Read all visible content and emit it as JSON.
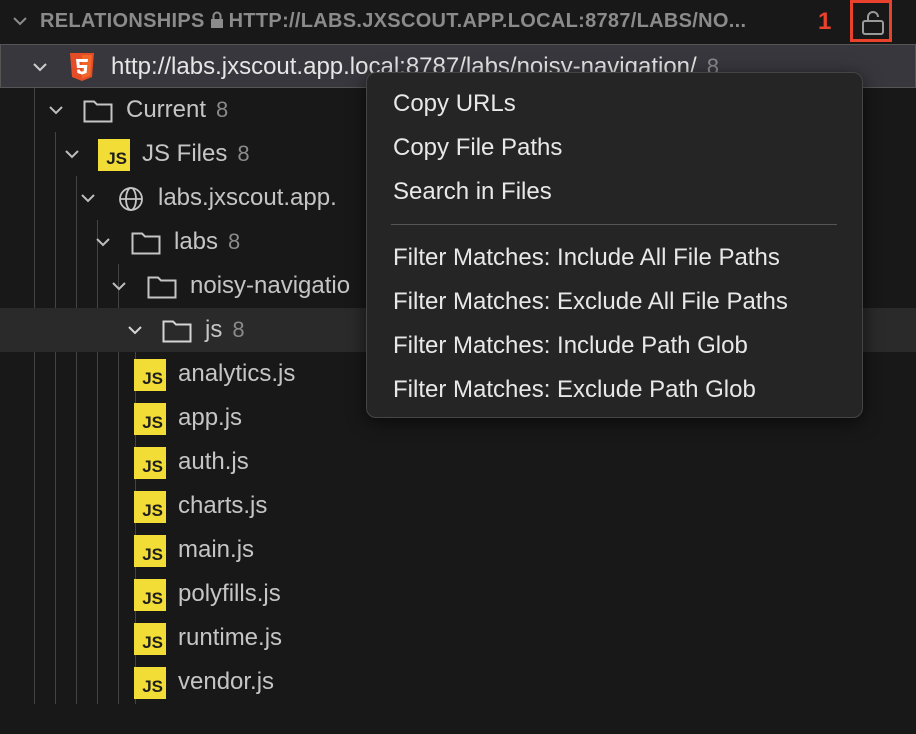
{
  "header": {
    "title_prefix": "RELATIONSHIPS",
    "title_suffix": "HTTP://LABS.JXSCOUT.APP.LOCAL:8787/LABS/NO...",
    "annotation_number": "1"
  },
  "tree": {
    "root": {
      "label": "http://labs.jxscout.app.local:8787/labs/noisy-navigation/",
      "count": "8"
    },
    "current": {
      "label": "Current",
      "count": "8"
    },
    "js_files": {
      "label": "JS Files",
      "count": "8"
    },
    "host": {
      "label": "labs.jxscout.app."
    },
    "labs": {
      "label": "labs",
      "count": "8"
    },
    "noisy": {
      "label": "noisy-navigatio"
    },
    "js_folder": {
      "label": "js",
      "count": "8"
    },
    "files": [
      "analytics.js",
      "app.js",
      "auth.js",
      "charts.js",
      "main.js",
      "polyfills.js",
      "runtime.js",
      "vendor.js"
    ],
    "js_icon_text": "JS"
  },
  "context_menu": {
    "items": [
      "Copy URLs",
      "Copy File Paths",
      "Search in Files",
      "Filter Matches: Include All File Paths",
      "Filter Matches: Exclude All File Paths",
      "Filter Matches: Include Path Glob",
      "Filter Matches: Exclude Path Glob"
    ]
  },
  "colors": {
    "background": "#181818",
    "js_icon": "#f1dd35",
    "html5_icon": "#e44d26",
    "annotation": "#e8412c"
  }
}
